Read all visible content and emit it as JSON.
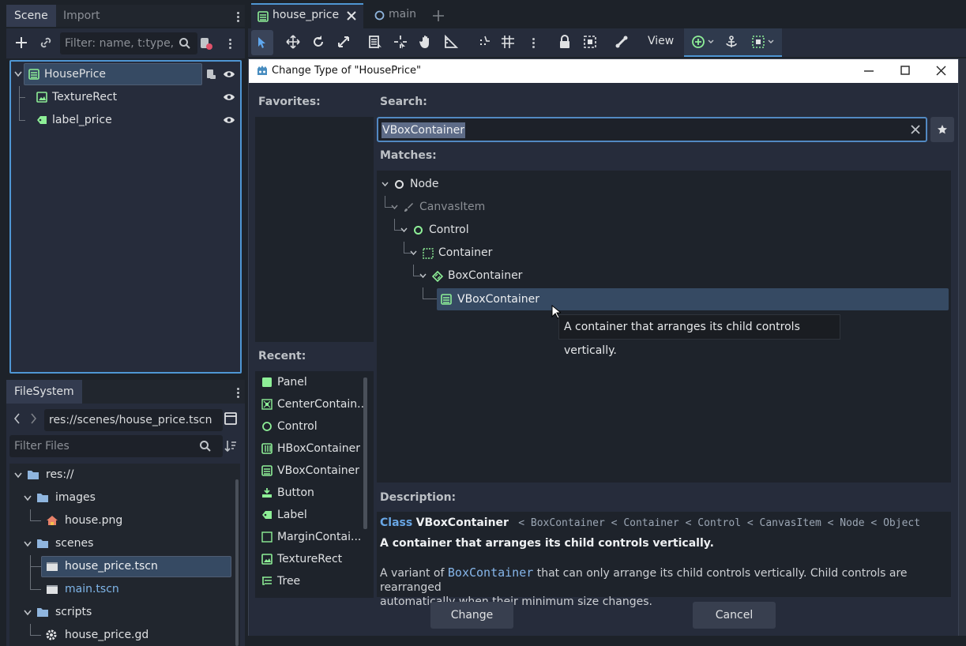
{
  "scene_dock": {
    "tabs": [
      "Scene",
      "Import"
    ],
    "filter_placeholder": "Filter: name, t:type,",
    "nodes": [
      {
        "label": "HousePrice",
        "icon": "vbox-icon"
      },
      {
        "label": "TextureRect",
        "icon": "texture-rect-icon"
      },
      {
        "label": "label_price",
        "icon": "label-icon"
      }
    ]
  },
  "filesystem_dock": {
    "tab": "FileSystem",
    "path": "res://scenes/house_price.tscn",
    "filter_placeholder": "Filter Files",
    "items": [
      {
        "label": "res://",
        "type": "folder"
      },
      {
        "label": "images",
        "type": "folder"
      },
      {
        "label": "house.png",
        "type": "image"
      },
      {
        "label": "scenes",
        "type": "folder"
      },
      {
        "label": "house_price.tscn",
        "type": "scene"
      },
      {
        "label": "main.tscn",
        "type": "scene"
      },
      {
        "label": "scripts",
        "type": "folder"
      },
      {
        "label": "house_price.gd",
        "type": "script"
      }
    ]
  },
  "editor_tabs": [
    {
      "label": "house_price",
      "active": true
    },
    {
      "label": "main",
      "active": false
    }
  ],
  "toolbar": {
    "view_label": "View"
  },
  "dialog": {
    "title": "Change Type of \"HousePrice\"",
    "favorites_label": "Favorites:",
    "recent_label": "Recent:",
    "search_label": "Search:",
    "search_value": "VBoxContainer",
    "matches_label": "Matches:",
    "matches": [
      {
        "label": "Node",
        "color": "#dfe1e3"
      },
      {
        "label": "CanvasItem",
        "color": "#8a8e94"
      },
      {
        "label": "Control",
        "color": "#dfe1e3"
      },
      {
        "label": "Container",
        "color": "#dfe1e3"
      },
      {
        "label": "BoxContainer",
        "color": "#dfe1e3"
      },
      {
        "label": "VBoxContainer",
        "color": "#eef0f2"
      }
    ],
    "tooltip": "A container that arranges its child controls vertically.",
    "recent": [
      "Panel",
      "CenterContain...",
      "Control",
      "HBoxContainer",
      "VBoxContainer",
      "Button",
      "Label",
      "MarginContai...",
      "TextureRect",
      "Tree"
    ],
    "description_label": "Description:",
    "class_keyword": "Class",
    "class_name": "VBoxContainer",
    "inheritance": [
      "BoxContainer",
      "Container",
      "Control",
      "CanvasItem",
      "Node",
      "Object"
    ],
    "summary": "A container that arranges its child controls vertically.",
    "desc_prefix": "A variant of",
    "desc_link": "BoxContainer",
    "desc_suffix": "that can only arrange its child controls vertically. Child controls are rearranged",
    "desc_line2": "automatically when their minimum size changes.",
    "change_button": "Change",
    "cancel_button": "Cancel"
  },
  "colors": {
    "accent": "#4f96d3",
    "green_icon": "#8eef97",
    "selection": "#364a63"
  }
}
